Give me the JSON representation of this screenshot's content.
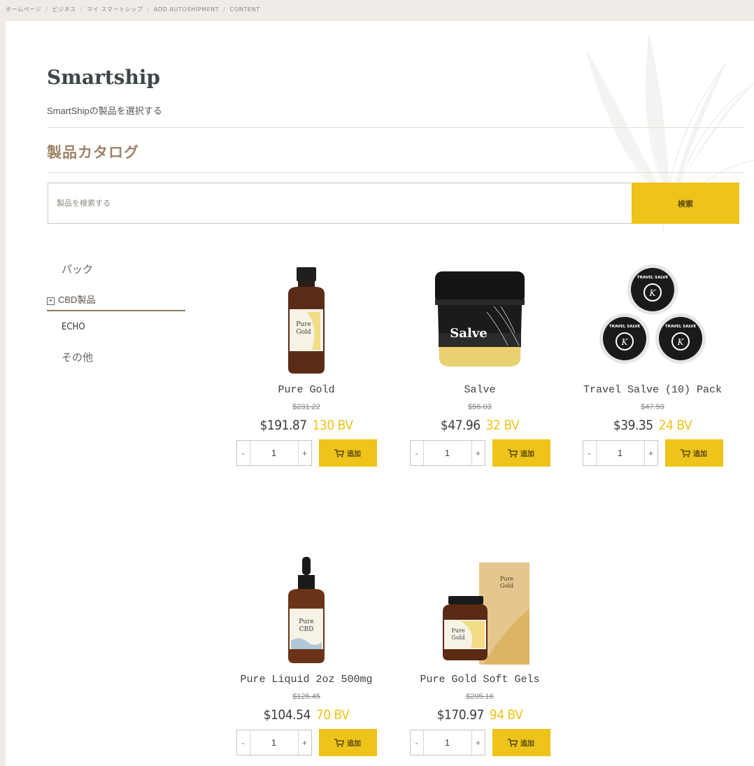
{
  "breadcrumb": [
    "ホームページ",
    "ビジネス",
    "マイ スマートシップ",
    "ADD AUTOSHIPMENT",
    "CONTENT"
  ],
  "header": {
    "title": "Smartship",
    "subtitle": "SmartShipの製品を選択する",
    "catalog_heading": "製品カタログ"
  },
  "search": {
    "placeholder": "製品を検索する",
    "button_label": "検索"
  },
  "categories": {
    "packs": "パック",
    "cbd": "CBD製品",
    "echo": "ECHO",
    "other": "その他"
  },
  "add_label": "追加",
  "qty_minus": "-",
  "qty_plus": "+",
  "products": [
    {
      "name": "Pure Gold",
      "original_price": "$231.22",
      "price": "$191.87",
      "bv": "130 BV",
      "qty": "1",
      "image": "amber-bottle-pure-gold"
    },
    {
      "name": "Salve",
      "original_price": "$56.03",
      "price": "$47.96",
      "bv": "32 BV",
      "qty": "1",
      "image": "salve-jar"
    },
    {
      "name": "Travel Salve (10) Pack",
      "original_price": "$47.59",
      "price": "$39.35",
      "bv": "24 BV",
      "qty": "1",
      "image": "travel-salve-tins"
    },
    {
      "name": "Pure Liquid 2oz 500mg",
      "original_price": "$125.45",
      "price": "$104.54",
      "bv": "70 BV",
      "qty": "1",
      "image": "dropper-bottle-pure-cbd"
    },
    {
      "name": "Pure Gold Soft Gels",
      "original_price": "$205.16",
      "price": "$170.97",
      "bv": "94 BV",
      "qty": "1",
      "image": "soft-gels-jar-and-box"
    }
  ],
  "image_labels": {
    "pure_gold": [
      "Pure",
      "Gold"
    ],
    "salve": "Salve",
    "tin": "TRAVEL SALVE",
    "pure_cbd": [
      "Pure",
      "CBD"
    ]
  },
  "colors": {
    "accent": "#eec31a",
    "catalog_heading": "#9c8468",
    "background": "#efece7"
  }
}
